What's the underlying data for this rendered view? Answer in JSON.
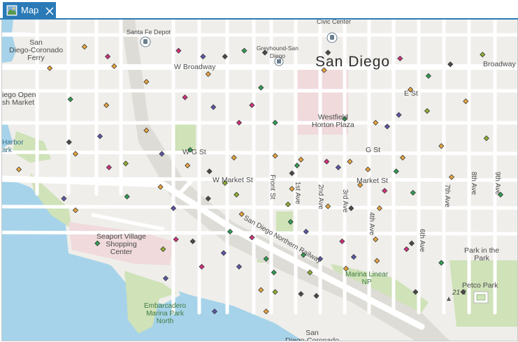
{
  "tab": {
    "label": "Map",
    "icon": "map-icon",
    "close_icon": "close-icon",
    "color": "#2a7ab8"
  },
  "map": {
    "city_label": "San Diego",
    "labels": {
      "san_diego_coronado_ferry": "San\nDiego-Coronado\nFerry",
      "santa_fe_depot": "Santa Fe Depot",
      "civic_center": "Civic Center",
      "greyhound": "Greyhound-San\nDiego",
      "w_broadway": "W Broadway",
      "broadway": "Broadway",
      "e_st": "E St",
      "diego_open_market": "iego Open\nsh Market",
      "westfield": "Westfield\nHorton Plaza",
      "harbor": "Harbor\nark",
      "w_g_st": "W G St",
      "g_st": "G St",
      "w_market_st": "W Market St",
      "market_st": "Market St",
      "front_st": "Front St",
      "first_ave": "1st Ave",
      "second_ave": "2nd Ave",
      "third_ave": "3rd Ave",
      "fourth_ave": "4th Ave",
      "sixth_ave": "6th Ave",
      "seventh_ave": "7th Ave",
      "eighth_ave": "8th Ave",
      "ninth_ave": "9th Ave",
      "seaport_village": "Seaport Village\nShopping\nCenter",
      "northern_railway": "San Diego Northern Railway",
      "park_in_the_park": "Park in the\nPark",
      "marina_linear": "Marina Linear\nNP",
      "petco_park": "Petco Park",
      "elevation": "21 ft",
      "embarcadero": "Embarcadero\nMarina Park\nNorth",
      "san_diego_coronado_bottom": "San\nDiego-Coronado"
    },
    "icons": [
      "train-station-icon",
      "train-station-icon",
      "bus-station-icon",
      "stadium-icon",
      "elevation-marker-icon"
    ],
    "colors": {
      "land": "#efeeea",
      "road": "#ffffff",
      "road_edge": "#dcdad4",
      "water": "#a6d3ea",
      "park": "#cfe2b8",
      "pink": "#f0dadc",
      "rail": "#d2d0cc",
      "point_palette": [
        "#e8a33d",
        "#2f9d52",
        "#cf2f7a",
        "#5c56a6",
        "#d7632b",
        "#4a4a4a"
      ]
    },
    "points": [
      {
        "lon": -117.1711,
        "lat": 32.7156,
        "cat": "orange"
      },
      {
        "lon": -117.1693,
        "lat": 32.7151,
        "cat": "magenta"
      },
      {
        "lon": -117.1638,
        "lat": 32.7154,
        "cat": "magenta"
      },
      {
        "lon": -117.1619,
        "lat": 32.7151,
        "cat": "purple"
      },
      {
        "lon": -117.1587,
        "lat": 32.7154,
        "cat": "green"
      },
      {
        "lon": -117.1571,
        "lat": 32.7153,
        "cat": "dark"
      },
      {
        "lon": -117.1522,
        "lat": 32.7153,
        "cat": "dark"
      },
      {
        "lon": -117.1466,
        "lat": 32.715,
        "cat": "magenta"
      },
      {
        "lon": -117.1427,
        "lat": 32.7147,
        "cat": "dark"
      },
      {
        "lon": -117.1402,
        "lat": 32.7152,
        "cat": "olive"
      },
      {
        "lon": -117.1738,
        "lat": 32.7145,
        "cat": "orange"
      },
      {
        "lon": -117.1688,
        "lat": 32.7146,
        "cat": "orange"
      },
      {
        "lon": -117.1663,
        "lat": 32.7138,
        "cat": "orange"
      },
      {
        "lon": -117.1615,
        "lat": 32.7142,
        "cat": "orange"
      },
      {
        "lon": -117.1602,
        "lat": 32.7151,
        "cat": "dark"
      },
      {
        "lon": -117.1525,
        "lat": 32.7144,
        "cat": "orange"
      },
      {
        "lon": -117.1444,
        "lat": 32.7141,
        "cat": "green"
      },
      {
        "lon": -117.1458,
        "lat": 32.7134,
        "cat": "orange"
      },
      {
        "lon": -117.1722,
        "lat": 32.7129,
        "cat": "green"
      },
      {
        "lon": -117.1694,
        "lat": 32.7126,
        "cat": "orange"
      },
      {
        "lon": -117.1633,
        "lat": 32.713,
        "cat": "magenta"
      },
      {
        "lon": -117.1611,
        "lat": 32.7125,
        "cat": "purple"
      },
      {
        "lon": -117.1574,
        "lat": 32.7135,
        "cat": "green"
      },
      {
        "lon": -117.1581,
        "lat": 32.7126,
        "cat": "magenta"
      },
      {
        "lon": -117.1509,
        "lat": 32.7119,
        "cat": "green"
      },
      {
        "lon": -117.1467,
        "lat": 32.7121,
        "cat": "purple"
      },
      {
        "lon": -117.1445,
        "lat": 32.7123,
        "cat": "olive"
      },
      {
        "lon": -117.1415,
        "lat": 32.7128,
        "cat": "orange"
      },
      {
        "lon": -117.1663,
        "lat": 32.7113,
        "cat": "orange"
      },
      {
        "lon": -117.1591,
        "lat": 32.7117,
        "cat": "magenta"
      },
      {
        "lon": -117.1563,
        "lat": 32.7117,
        "cat": "green"
      },
      {
        "lon": -117.1485,
        "lat": 32.7117,
        "cat": "orange"
      },
      {
        "lon": -117.1476,
        "lat": 32.7115,
        "cat": "purple"
      },
      {
        "lon": -117.1399,
        "lat": 32.7109,
        "cat": "olive"
      },
      {
        "lon": -117.1723,
        "lat": 32.7107,
        "cat": "dark"
      },
      {
        "lon": -117.1699,
        "lat": 32.711,
        "cat": "purple"
      },
      {
        "lon": -117.1718,
        "lat": 32.7101,
        "cat": "orange"
      },
      {
        "lon": -117.1651,
        "lat": 32.7101,
        "cat": "purple"
      },
      {
        "lon": -117.1629,
        "lat": 32.7103,
        "cat": "green"
      },
      {
        "lon": -117.1595,
        "lat": 32.7099,
        "cat": "orange"
      },
      {
        "lon": -117.1563,
        "lat": 32.71,
        "cat": "orange"
      },
      {
        "lon": -117.1543,
        "lat": 32.7098,
        "cat": "orange"
      },
      {
        "lon": -117.1523,
        "lat": 32.7097,
        "cat": "magenta"
      },
      {
        "lon": -117.1505,
        "lat": 32.7097,
        "cat": "orange"
      },
      {
        "lon": -117.1464,
        "lat": 32.7099,
        "cat": "orange"
      },
      {
        "lon": -117.1434,
        "lat": 32.7105,
        "cat": "orange"
      },
      {
        "lon": -117.1762,
        "lat": 32.7093,
        "cat": "orange"
      },
      {
        "lon": -117.1692,
        "lat": 32.7094,
        "cat": "magenta"
      },
      {
        "lon": -117.1679,
        "lat": 32.7096,
        "cat": "olive"
      },
      {
        "lon": -117.1631,
        "lat": 32.7095,
        "cat": "orange"
      },
      {
        "lon": -117.1614,
        "lat": 32.7092,
        "cat": "dark"
      },
      {
        "lon": -117.155,
        "lat": 32.7091,
        "cat": "dark"
      },
      {
        "lon": -117.1546,
        "lat": 32.7095,
        "cat": "green"
      },
      {
        "lon": -117.1514,
        "lat": 32.7094,
        "cat": "purple"
      },
      {
        "lon": -117.1491,
        "lat": 32.7093,
        "cat": "orange"
      },
      {
        "lon": -117.1469,
        "lat": 32.7092,
        "cat": "green"
      },
      {
        "lon": -117.1426,
        "lat": 32.7089,
        "cat": "orange"
      },
      {
        "lon": -117.1652,
        "lat": 32.7084,
        "cat": "orange"
      },
      {
        "lon": -117.1602,
        "lat": 32.7086,
        "cat": "olive"
      },
      {
        "lon": -117.1593,
        "lat": 32.708,
        "cat": "olive"
      },
      {
        "lon": -117.155,
        "lat": 32.7083,
        "cat": "orange"
      },
      {
        "lon": -117.1497,
        "lat": 32.7085,
        "cat": "orange"
      },
      {
        "lon": -117.1478,
        "lat": 32.7082,
        "cat": "magenta"
      },
      {
        "lon": -117.1456,
        "lat": 32.7081,
        "cat": "green"
      },
      {
        "lon": -117.1388,
        "lat": 32.708,
        "cat": "green"
      },
      {
        "lon": -117.1727,
        "lat": 32.7078,
        "cat": "purple"
      },
      {
        "lon": -117.1678,
        "lat": 32.7079,
        "cat": "green"
      },
      {
        "lon": -117.1615,
        "lat": 32.7078,
        "cat": "dark"
      },
      {
        "lon": -117.1553,
        "lat": 32.7075,
        "cat": "olive"
      },
      {
        "lon": -117.1522,
        "lat": 32.7074,
        "cat": "orange"
      },
      {
        "lon": -117.1504,
        "lat": 32.7073,
        "cat": "dark"
      },
      {
        "lon": -117.1482,
        "lat": 32.7073,
        "cat": "orange"
      },
      {
        "lon": -117.1718,
        "lat": 32.7072,
        "cat": "orange"
      },
      {
        "lon": -117.1642,
        "lat": 32.7073,
        "cat": "purple"
      },
      {
        "lon": -117.1589,
        "lat": 32.707,
        "cat": "orange"
      },
      {
        "lon": -117.1551,
        "lat": 32.7066,
        "cat": "green"
      },
      {
        "lon": -117.1539,
        "lat": 32.7061,
        "cat": "purple"
      },
      {
        "lon": -117.1598,
        "lat": 32.7061,
        "cat": "green"
      },
      {
        "lon": -117.1581,
        "lat": 32.7058,
        "cat": "magenta"
      },
      {
        "lon": -117.1511,
        "lat": 32.7056,
        "cat": "magenta"
      },
      {
        "lon": -117.1485,
        "lat": 32.7057,
        "cat": "orange"
      },
      {
        "lon": -117.1457,
        "lat": 32.7055,
        "cat": "dark"
      },
      {
        "lon": -117.1701,
        "lat": 32.7055,
        "cat": "green"
      },
      {
        "lon": -117.165,
        "lat": 32.7052,
        "cat": "olive"
      },
      {
        "lon": -117.164,
        "lat": 32.7057,
        "cat": "magenta"
      },
      {
        "lon": -117.1627,
        "lat": 32.7056,
        "cat": "dark"
      },
      {
        "lon": -117.1603,
        "lat": 32.705,
        "cat": "purple"
      },
      {
        "lon": -117.157,
        "lat": 32.7047,
        "cat": "green"
      },
      {
        "lon": -117.1541,
        "lat": 32.7049,
        "cat": "green"
      },
      {
        "lon": -117.1528,
        "lat": 32.7047,
        "cat": "purple"
      },
      {
        "lon": -117.1502,
        "lat": 32.7048,
        "cat": "purple"
      },
      {
        "lon": -117.1461,
        "lat": 32.7052,
        "cat": "magenta"
      },
      {
        "lon": -117.162,
        "lat": 32.7043,
        "cat": "magenta"
      },
      {
        "lon": -117.1591,
        "lat": 32.7043,
        "cat": "purple"
      },
      {
        "lon": -117.1564,
        "lat": 32.704,
        "cat": "green"
      },
      {
        "lon": -117.1536,
        "lat": 32.704,
        "cat": "olive"
      },
      {
        "lon": -117.1508,
        "lat": 32.7042,
        "cat": "orange"
      },
      {
        "lon": -117.1484,
        "lat": 32.7046,
        "cat": "orange"
      },
      {
        "lon": -117.1434,
        "lat": 32.7045,
        "cat": "green"
      },
      {
        "lon": -117.1648,
        "lat": 32.7037,
        "cat": "purple"
      },
      {
        "lon": -117.1574,
        "lat": 32.7031,
        "cat": "orange"
      },
      {
        "lon": -117.1563,
        "lat": 32.703,
        "cat": "olive"
      },
      {
        "lon": -117.1543,
        "lat": 32.7029,
        "cat": "dark"
      },
      {
        "lon": -117.1531,
        "lat": 32.7028,
        "cat": "dark"
      },
      {
        "lon": -117.1454,
        "lat": 32.703,
        "cat": "dark"
      },
      {
        "lon": -117.1417,
        "lat": 32.703,
        "cat": "dark"
      },
      {
        "lon": -117.161,
        "lat": 32.702,
        "cat": "purple"
      },
      {
        "lon": -117.157,
        "lat": 32.702,
        "cat": "orange"
      }
    ]
  }
}
